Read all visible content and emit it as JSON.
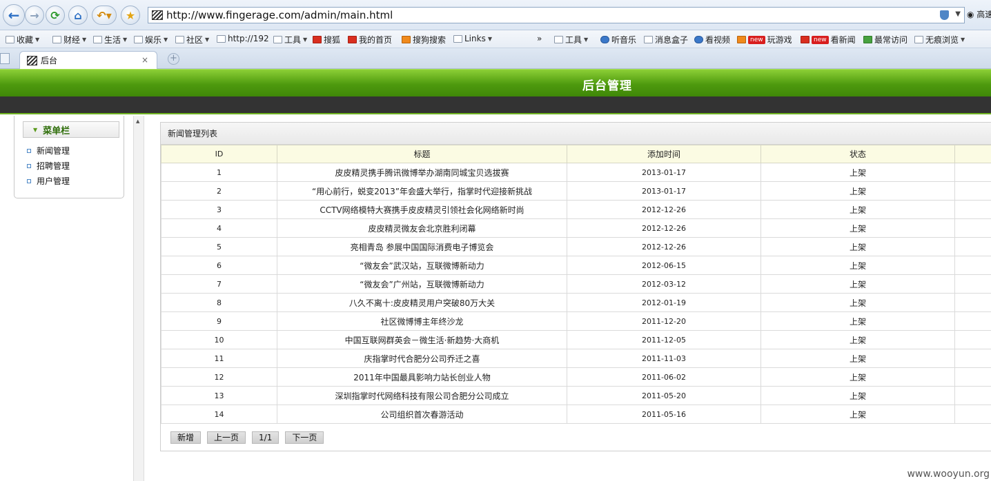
{
  "browser": {
    "url": "http://www.fingerage.com/admin/main.html",
    "search_hint": "高速",
    "tab_title": "后台",
    "tab_close": "×",
    "tab_new": "+",
    "bookmarks": [
      {
        "label": "收藏",
        "arrow": true,
        "icon": "plus-icon"
      },
      {
        "label": "财经",
        "arrow": true,
        "icon": "folder-icon"
      },
      {
        "label": "生活",
        "arrow": true,
        "icon": "folder-icon"
      },
      {
        "label": "娱乐",
        "arrow": true,
        "icon": "folder-icon"
      },
      {
        "label": "社区",
        "arrow": true,
        "icon": "folder-icon"
      },
      {
        "label": "http://192",
        "arrow": false,
        "icon": "page-icon"
      },
      {
        "label": "工具",
        "arrow": true,
        "icon": "folder-icon"
      },
      {
        "label": "搜狐",
        "arrow": false,
        "icon": "sohu-icon"
      },
      {
        "label": "我的首页",
        "arrow": false,
        "icon": "weibo-icon"
      },
      {
        "label": "搜狗搜索",
        "arrow": false,
        "icon": "sogou-icon"
      },
      {
        "label": "Links",
        "arrow": true,
        "icon": "folder-icon"
      },
      {
        "label": "»",
        "arrow": false,
        "icon": ""
      },
      {
        "label": "工具",
        "arrow": true,
        "icon": "tools-icon"
      },
      {
        "label": "听音乐",
        "arrow": false,
        "icon": "music-icon"
      },
      {
        "label": "消息盒子",
        "arrow": false,
        "icon": "message-icon"
      },
      {
        "label": "看视频",
        "arrow": false,
        "icon": "video-icon"
      },
      {
        "label": "玩游戏",
        "arrow": false,
        "icon": "game-icon",
        "badge": "new"
      },
      {
        "label": "看新闻",
        "arrow": false,
        "icon": "news-icon",
        "badge": "new"
      },
      {
        "label": "最常访问",
        "arrow": false,
        "icon": "frequent-icon"
      },
      {
        "label": "无痕浏览",
        "arrow": true,
        "icon": "private-icon"
      }
    ]
  },
  "page": {
    "banner_title": "后台管理",
    "sidebar": {
      "title": "菜单栏",
      "items": [
        "新闻管理",
        "招聘管理",
        "用户管理"
      ]
    },
    "list": {
      "heading": "新闻管理列表",
      "columns": [
        "ID",
        "标题",
        "添加时间",
        "状态",
        ""
      ],
      "rows": [
        {
          "id": "1",
          "title": "皮皮精灵携手腾讯微博举办湖南同城宝贝选拔赛",
          "date": "2013-01-17",
          "status": "上架"
        },
        {
          "id": "2",
          "title": "“用心前行，蜕变2013”年会盛大举行，指掌时代迎接新挑战",
          "date": "2013-01-17",
          "status": "上架"
        },
        {
          "id": "3",
          "title": "CCTV网络模特大赛携手皮皮精灵引领社会化网络新时尚",
          "date": "2012-12-26",
          "status": "上架"
        },
        {
          "id": "4",
          "title": "皮皮精灵微友会北京胜利闭幕",
          "date": "2012-12-26",
          "status": "上架"
        },
        {
          "id": "5",
          "title": "亮相青岛 参展中国国际消费电子博览会",
          "date": "2012-12-26",
          "status": "上架"
        },
        {
          "id": "6",
          "title": "“微友会”武汉站，互联微博新动力",
          "date": "2012-06-15",
          "status": "上架"
        },
        {
          "id": "7",
          "title": "“微友会”广州站，互联微博新动力",
          "date": "2012-03-12",
          "status": "上架"
        },
        {
          "id": "8",
          "title": "八久不离十:皮皮精灵用户突破80万大关",
          "date": "2012-01-19",
          "status": "上架"
        },
        {
          "id": "9",
          "title": "社区微博博主年终沙龙",
          "date": "2011-12-20",
          "status": "上架"
        },
        {
          "id": "10",
          "title": "中国互联网群英会－微生活·新趋势·大商机",
          "date": "2011-12-05",
          "status": "上架"
        },
        {
          "id": "11",
          "title": "庆指掌时代合肥分公司乔迁之喜",
          "date": "2011-11-03",
          "status": "上架"
        },
        {
          "id": "12",
          "title": "2011年中国最具影响力站长创业人物",
          "date": "2011-06-02",
          "status": "上架"
        },
        {
          "id": "13",
          "title": "深圳指掌时代网络科技有限公司合肥分公司成立",
          "date": "2011-05-20",
          "status": "上架"
        },
        {
          "id": "14",
          "title": "公司组织首次春游活动",
          "date": "2011-05-16",
          "status": "上架"
        }
      ]
    },
    "pager": {
      "add": "新增",
      "prev": "上一页",
      "page_info": "1/1",
      "next": "下一页"
    },
    "watermark": "www.wooyun.org"
  },
  "colors": {
    "banner_green": "#4e9a0e",
    "dark_bar": "#333333",
    "header_row": "#fbfbe3"
  }
}
